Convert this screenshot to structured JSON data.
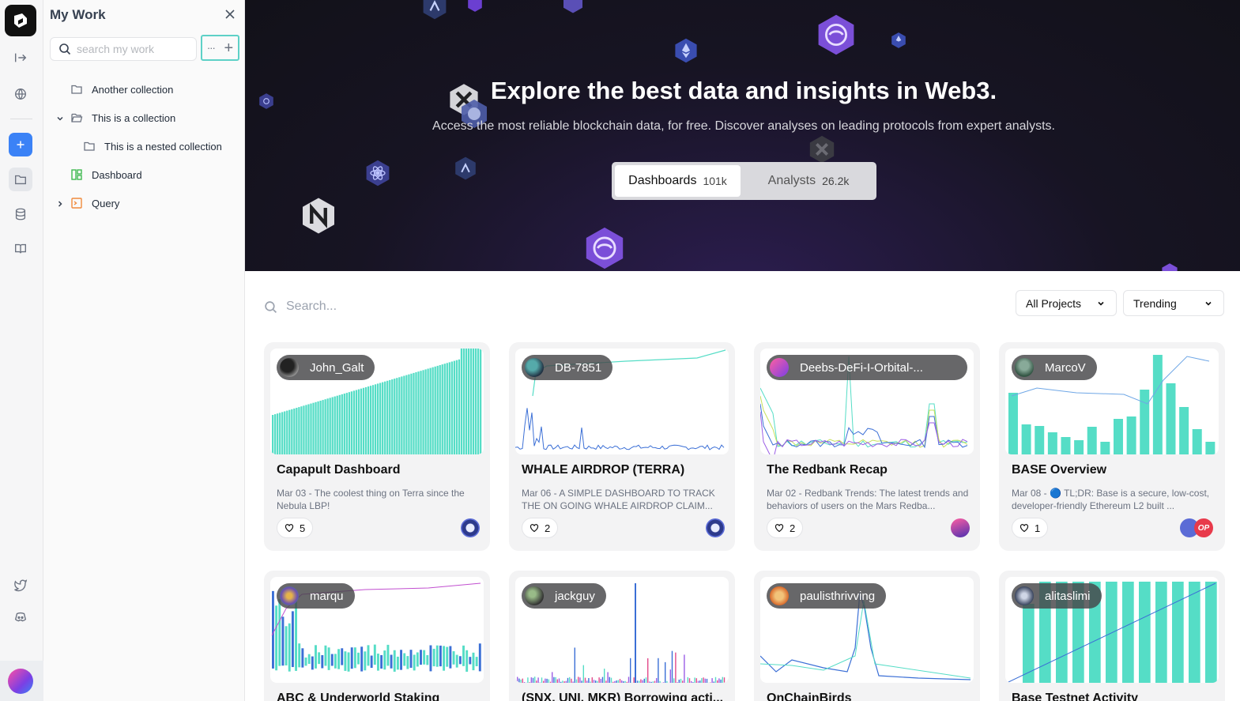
{
  "panel": {
    "title": "My Work",
    "search_placeholder": "search my work",
    "more_label": "···",
    "add_label": "+",
    "tree": [
      {
        "label": "Another collection",
        "type": "collection"
      },
      {
        "label": "This is a collection",
        "type": "collection",
        "expanded": true
      },
      {
        "label": "This is a nested collection",
        "type": "collection"
      },
      {
        "label": "Dashboard",
        "type": "dashboard"
      },
      {
        "label": "Query",
        "type": "query",
        "collapsed": true
      }
    ]
  },
  "hero": {
    "title": "Explore the best data and insights in Web3.",
    "subtitle": "Access the most reliable blockchain data, for free. Discover analyses on leading protocols from expert analysts.",
    "tabs": [
      {
        "label": "Dashboards",
        "count": "101k"
      },
      {
        "label": "Analysts",
        "count": "26.2k"
      }
    ]
  },
  "filters": {
    "search_placeholder": "Search...",
    "projects": "All Projects",
    "sort": "Trending"
  },
  "colors": {
    "accent": "#5ed1c7",
    "chart_teal": "#55ddc6",
    "hero_bg": "#171423",
    "rail_new": "#3b82f6"
  },
  "cards": [
    {
      "author": "John_Galt",
      "title": "Capapult Dashboard",
      "desc": "Mar 03 - The coolest thing on Terra since the Nebula LBP!",
      "likes": "5"
    },
    {
      "author": "DB-7851",
      "title": "WHALE AIRDROP (TERRA)",
      "desc": "Mar 06 - A SIMPLE DASHBOARD TO TRACK THE ON GOING WHALE AIRDROP CLAIM...",
      "likes": "2"
    },
    {
      "author": "Deebs-DeFi-I-Orbital-...",
      "title": "The Redbank Recap",
      "desc": "Mar 02 - Redbank Trends: The latest trends and behaviors of users on the Mars Redba...",
      "likes": "2"
    },
    {
      "author": "MarcoV",
      "title": "BASE Overview",
      "desc": "Mar 08 - 🔵 TL;DR: Base is a secure, low-cost, developer-friendly Ethereum L2 built ...",
      "likes": "1",
      "chain_label": "OP"
    },
    {
      "author": "marqu",
      "title": "ABC & Underworld Staking"
    },
    {
      "author": "jackguy",
      "title": "(SNX, UNI, MKR) Borrowing acti..."
    },
    {
      "author": "paulisthrivving",
      "title": "OnChainBirds"
    },
    {
      "author": "alitaslimi",
      "title": "Base Testnet Activity"
    }
  ]
}
